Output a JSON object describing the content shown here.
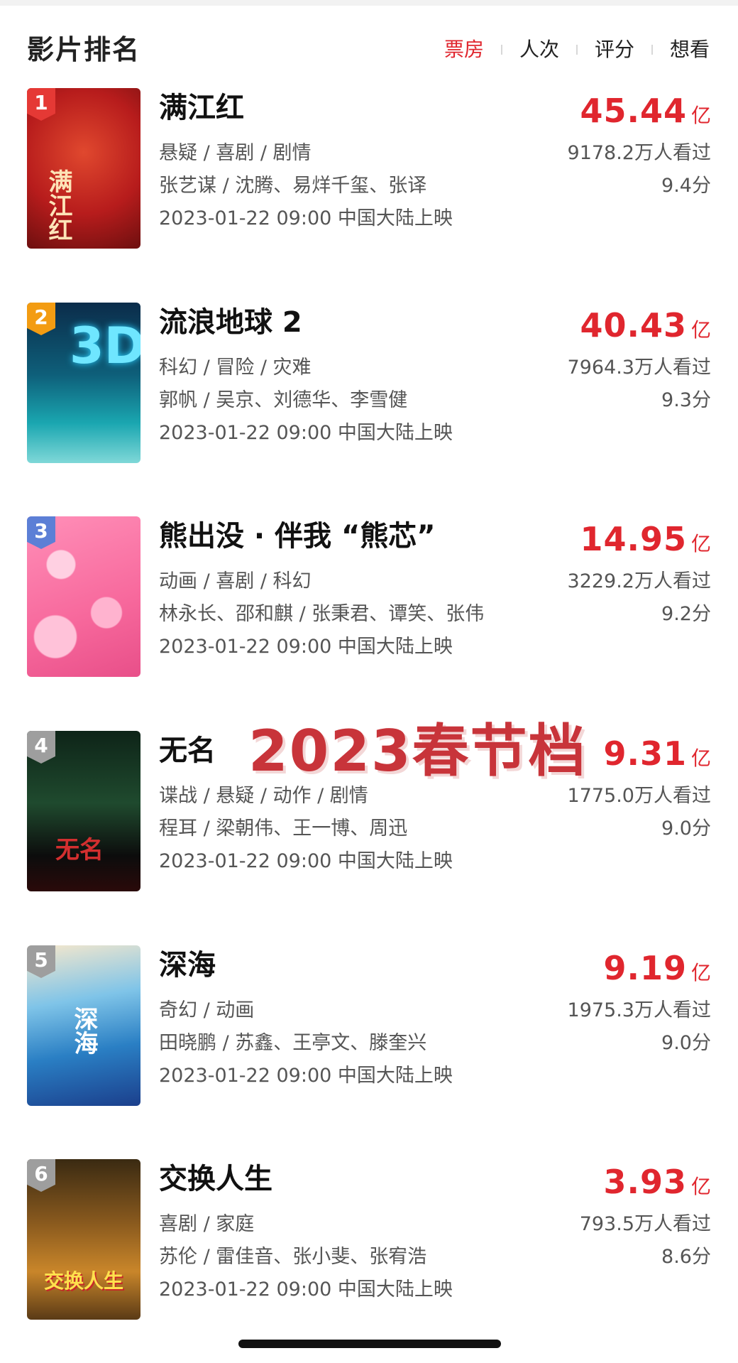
{
  "header": {
    "title": "影片排名",
    "tabs": [
      {
        "label": "票房",
        "active": true
      },
      {
        "label": "人次",
        "active": false
      },
      {
        "label": "评分",
        "active": false
      },
      {
        "label": "想看",
        "active": false
      }
    ]
  },
  "overlay_text": "2023春节档",
  "movies": [
    {
      "rank": "1",
      "title": "满江红",
      "box_office": "45.44",
      "unit": "亿",
      "genre": "悬疑 / 喜剧 / 剧情",
      "cast": "张艺谋 / 沈腾、易烊千玺、张译",
      "release": "2023-01-22 09:00 中国大陆上映",
      "viewers": "9178.2万人看过",
      "score": "9.4分",
      "poster_text": "满江红",
      "badge_color": "#e53935"
    },
    {
      "rank": "2",
      "title": "流浪地球 2",
      "box_office": "40.43",
      "unit": "亿",
      "genre": "科幻 / 冒险 / 灾难",
      "cast": "郭帆 / 吴京、刘德华、李雪健",
      "release": "2023-01-22 09:00 中国大陆上映",
      "viewers": "7964.3万人看过",
      "score": "9.3分",
      "poster_text": "3D",
      "badge_color": "#f39c12"
    },
    {
      "rank": "3",
      "title": "熊出没 · 伴我 “熊芯”",
      "box_office": "14.95",
      "unit": "亿",
      "genre": "动画 / 喜剧 / 科幻",
      "cast": "林永长、邵和麒 / 张秉君、谭笑、张伟",
      "release": "2023-01-22 09:00 中国大陆上映",
      "viewers": "3229.2万人看过",
      "score": "9.2分",
      "poster_text": "",
      "badge_color": "#5c7fd6"
    },
    {
      "rank": "4",
      "title": "无名",
      "box_office": "9.31",
      "unit": "亿",
      "genre": "谍战 / 悬疑 / 动作 / 剧情",
      "cast": "程耳 / 梁朝伟、王一博、周迅",
      "release": "2023-01-22 09:00 中国大陆上映",
      "viewers": "1775.0万人看过",
      "score": "9.0分",
      "poster_text": "无名",
      "badge_color": "#9e9e9e"
    },
    {
      "rank": "5",
      "title": "深海",
      "box_office": "9.19",
      "unit": "亿",
      "genre": "奇幻 / 动画",
      "cast": "田晓鹏 / 苏鑫、王亭文、滕奎兴",
      "release": "2023-01-22 09:00 中国大陆上映",
      "viewers": "1975.3万人看过",
      "score": "9.0分",
      "poster_text": "深海",
      "badge_color": "#9e9e9e"
    },
    {
      "rank": "6",
      "title": "交换人生",
      "box_office": "3.93",
      "unit": "亿",
      "genre": "喜剧 / 家庭",
      "cast": "苏伦 / 雷佳音、张小斐、张宥浩",
      "release": "2023-01-22 09:00 中国大陆上映",
      "viewers": "793.5万人看过",
      "score": "8.6分",
      "poster_text": "交换人生",
      "badge_color": "#9e9e9e"
    }
  ]
}
